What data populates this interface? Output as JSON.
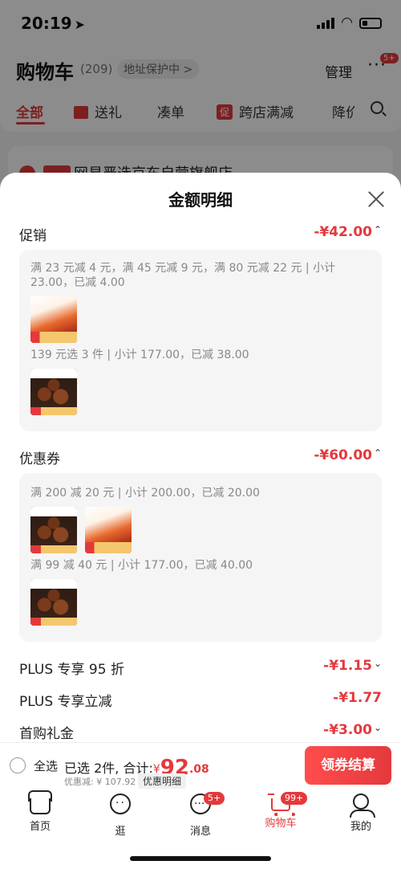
{
  "status_bar": {
    "time": "20:19"
  },
  "cart_header": {
    "title": "购物车",
    "count": "(209)",
    "address_protect": "地址保护中 >",
    "manage": "管理",
    "more_badge": "5+"
  },
  "filter_tabs": [
    {
      "label": "全部"
    },
    {
      "label": "送礼"
    },
    {
      "label": "凑单"
    },
    {
      "label": "跨店满减",
      "icon_text": "促"
    },
    {
      "label": "降价"
    }
  ],
  "store": {
    "name": "网易严选京东自营旗舰店"
  },
  "sheet": {
    "title": "金额明细",
    "promotion": {
      "label": "促销",
      "amount": "-¥42.00",
      "rule1": "满 23 元减 4 元，满 45 元减 9 元，满 80 元减 22 元 | 小计 23.00，已减 4.00",
      "rule2": "139 元选 3 件 | 小计 177.00，已减 38.00"
    },
    "coupon": {
      "label": "优惠券",
      "amount": "-¥60.00",
      "rule1": "满 200 减 20 元 | 小计 200.00，已减 20.00",
      "rule2": "满 99 减 40 元 | 小计 177.00，已减 40.00"
    },
    "plus_discount": {
      "label": "PLUS 专享 95 折",
      "amount": "-¥1.15"
    },
    "plus_instant": {
      "label": "PLUS 专享立减",
      "amount": "-¥1.77"
    },
    "first_gift": {
      "label": "首购礼金",
      "amount": "-¥3.00"
    }
  },
  "checkout": {
    "select_all": "全选",
    "selected_summary": "已选 2件, 合计:",
    "currency": "¥",
    "total_int": "92",
    "total_dec": ".08",
    "discount_text": "优惠减: ¥ 107.92",
    "detail_button": "优惠明细",
    "settle_button": "领券结算"
  },
  "tabbar": [
    {
      "label": "首页",
      "icon": "home-icon"
    },
    {
      "label": "逛",
      "icon": "browse-icon"
    },
    {
      "label": "消息",
      "icon": "message-icon",
      "badge": "5+"
    },
    {
      "label": "购物车",
      "icon": "cart-icon",
      "badge": "99+"
    },
    {
      "label": "我的",
      "icon": "profile-icon"
    }
  ],
  "colors": {
    "accent": "#e4393c",
    "overlay": "rgba(0,0,0,0.45)"
  }
}
